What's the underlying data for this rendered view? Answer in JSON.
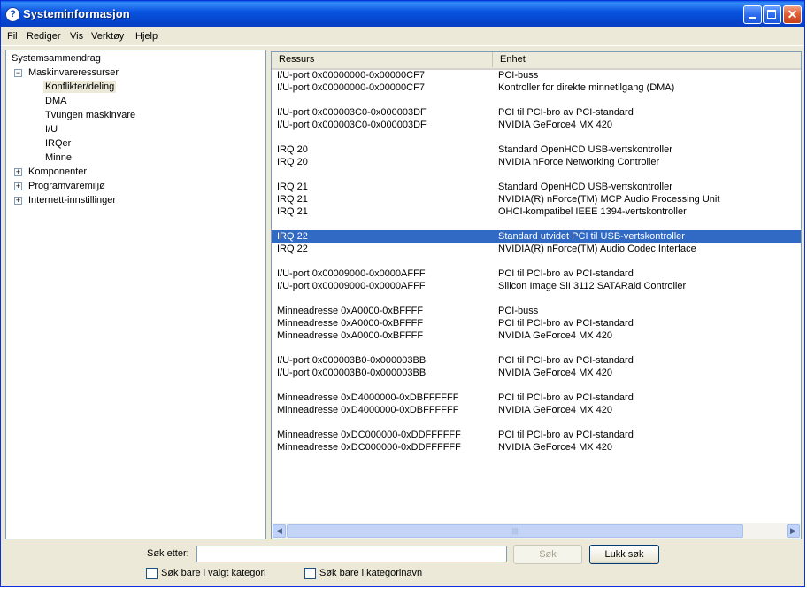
{
  "window": {
    "title": "Systeminformasjon",
    "app_icon": "?"
  },
  "menu": [
    "Fil",
    "Rediger",
    "Vis",
    "Verktøy",
    "Hjelp"
  ],
  "tree": {
    "root": "Systemsammendrag",
    "hardware": "Maskinvareressurser",
    "hardware_children": [
      "Konflikter/deling",
      "DMA",
      "Tvungen maskinvare",
      "I/U",
      "IRQer",
      "Minne"
    ],
    "components": "Komponenter",
    "software": "Programvaremiljø",
    "internet": "Internett-innstillinger",
    "expand_sign": "+",
    "collapse_sign": "−"
  },
  "list": {
    "columns": [
      "Ressurs",
      "Enhet"
    ],
    "rows": [
      [
        "I/U-port 0x00000000-0x00000CF7",
        "PCI-buss"
      ],
      [
        "I/U-port 0x00000000-0x00000CF7",
        "Kontroller for direkte minnetilgang (DMA)"
      ],
      [
        "",
        ""
      ],
      [
        "I/U-port 0x000003C0-0x000003DF",
        "PCI til PCI-bro av PCI-standard"
      ],
      [
        "I/U-port 0x000003C0-0x000003DF",
        "NVIDIA GeForce4 MX 420"
      ],
      [
        "",
        ""
      ],
      [
        "IRQ 20",
        "Standard OpenHCD USB-vertskontroller"
      ],
      [
        "IRQ 20",
        "NVIDIA nForce Networking Controller"
      ],
      [
        "",
        ""
      ],
      [
        "IRQ 21",
        "Standard OpenHCD USB-vertskontroller"
      ],
      [
        "IRQ 21",
        "NVIDIA(R) nForce(TM) MCP Audio Processing Unit"
      ],
      [
        "IRQ 21",
        "OHCI-kompatibel IEEE 1394-vertskontroller"
      ],
      [
        "",
        ""
      ],
      [
        "IRQ 22",
        "Standard utvidet PCI til USB-vertskontroller"
      ],
      [
        "IRQ 22",
        "NVIDIA(R) nForce(TM) Audio Codec Interface"
      ],
      [
        "",
        ""
      ],
      [
        "I/U-port 0x00009000-0x0000AFFF",
        "PCI til PCI-bro av PCI-standard"
      ],
      [
        "I/U-port 0x00009000-0x0000AFFF",
        "Silicon Image SiI 3112 SATARaid Controller"
      ],
      [
        "",
        ""
      ],
      [
        "Minneadresse 0xA0000-0xBFFFF",
        "PCI-buss"
      ],
      [
        "Minneadresse 0xA0000-0xBFFFF",
        "PCI til PCI-bro av PCI-standard"
      ],
      [
        "Minneadresse 0xA0000-0xBFFFF",
        "NVIDIA GeForce4 MX 420"
      ],
      [
        "",
        ""
      ],
      [
        "I/U-port 0x000003B0-0x000003BB",
        "PCI til PCI-bro av PCI-standard"
      ],
      [
        "I/U-port 0x000003B0-0x000003BB",
        "NVIDIA GeForce4 MX 420"
      ],
      [
        "",
        ""
      ],
      [
        "Minneadresse 0xD4000000-0xDBFFFFFF",
        "PCI til PCI-bro av PCI-standard"
      ],
      [
        "Minneadresse 0xD4000000-0xDBFFFFFF",
        "NVIDIA GeForce4 MX 420"
      ],
      [
        "",
        ""
      ],
      [
        "Minneadresse 0xDC000000-0xDDFFFFFF",
        "PCI til PCI-bro av PCI-standard"
      ],
      [
        "Minneadresse 0xDC000000-0xDDFFFFFF",
        "NVIDIA GeForce4 MX 420"
      ]
    ],
    "selected_row": 13
  },
  "search": {
    "label": "Søk etter:",
    "value": "",
    "search_button": "Søk",
    "close_button": "Lukk søk",
    "check_selected_category": "Søk bare i valgt kategori",
    "check_category_names": "Søk bare i kategorinavn"
  },
  "colors": {
    "titlebar": "#0854e0",
    "selection": "#316ac5",
    "window_bg": "#ece9d8"
  }
}
